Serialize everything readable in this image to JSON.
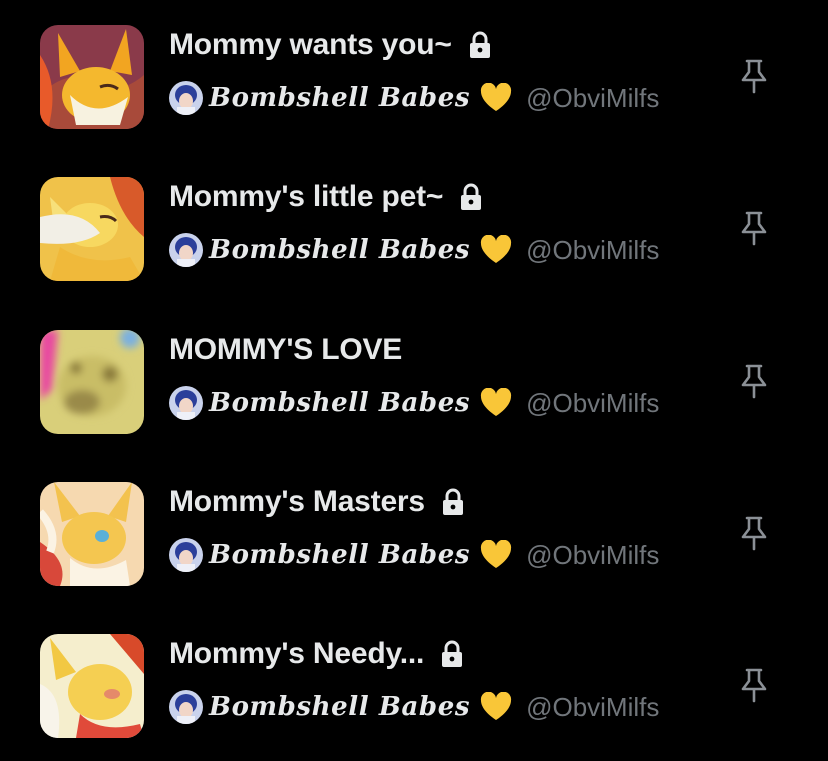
{
  "lists": [
    {
      "title": "Mommy wants you~",
      "locked": true,
      "owner": "𝑩𝒐𝒎𝒃𝒔𝒉𝒆𝒍𝒍 𝑩𝒂𝒃𝒆𝒔",
      "handle": "@ObviMilfs",
      "thumb": {
        "bg": "#8a3a4a",
        "fg": "#f2a521",
        "accent": "#e85a2a"
      }
    },
    {
      "title": "Mommy's little pet~",
      "locked": true,
      "owner": "𝑩𝒐𝒎𝒃𝒔𝒉𝒆𝒍𝒍 𝑩𝒂𝒃𝒆𝒔",
      "handle": "@ObviMilfs",
      "thumb": {
        "bg": "#f0c24a",
        "fg": "#f7e07a",
        "accent": "#e8e4d8"
      }
    },
    {
      "title": "MOMMY'S LOVE",
      "locked": false,
      "owner": "𝑩𝒐𝒎𝒃𝒔𝒉𝒆𝒍𝒍 𝑩𝒂𝒃𝒆𝒔",
      "handle": "@ObviMilfs",
      "thumb": {
        "bg": "#d9cf7a",
        "fg": "#b8a85a",
        "accent": "#e84aa0"
      }
    },
    {
      "title": "Mommy's Masters",
      "locked": true,
      "owner": "𝑩𝒐𝒎𝒃𝒔𝒉𝒆𝒍𝒍 𝑩𝒂𝒃𝒆𝒔",
      "handle": "@ObviMilfs",
      "thumb": {
        "bg": "#f6d9b0",
        "fg": "#f3c24e",
        "accent": "#d8483a"
      }
    },
    {
      "title": "Mommy's Needy...",
      "locked": true,
      "owner": "𝑩𝒐𝒎𝒃𝒔𝒉𝒆𝒍𝒍 𝑩𝒂𝒃𝒆𝒔",
      "handle": "@ObviMilfs",
      "thumb": {
        "bg": "#f5eecd",
        "fg": "#f2c843",
        "accent": "#d84a2a"
      }
    }
  ],
  "icons": {
    "lock": "lock-icon",
    "heart": "yellow-heart-icon",
    "pin": "pin-icon"
  },
  "colors": {
    "background": "#000000",
    "text_primary": "#e7e9ea",
    "text_secondary": "#71767b",
    "heart": "#f9c638"
  }
}
